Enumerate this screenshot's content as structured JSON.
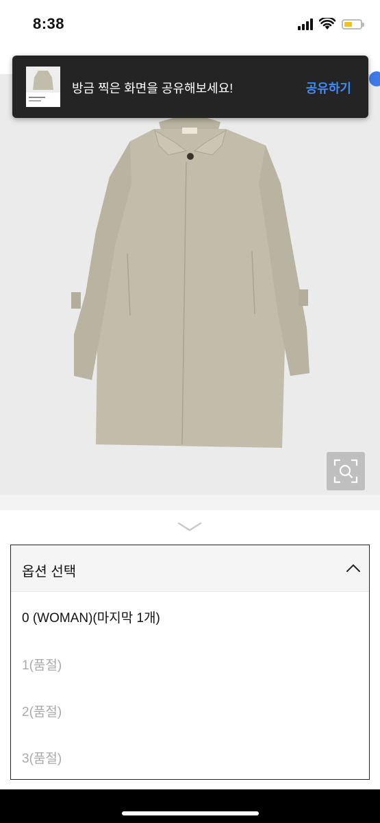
{
  "status_bar": {
    "time": "8:38",
    "battery_color": "#f4c21c"
  },
  "share_toast": {
    "message": "방금 찍은 화면을 공유해보세요!",
    "action_label": "공유하기",
    "action_color": "#3d8cff"
  },
  "product": {
    "zoom_icon": "zoom-search-icon",
    "coat_color": "#c1bba9"
  },
  "options": {
    "header_label": "옵션 선택",
    "items": [
      {
        "label": "0 (WOMAN)(마지막 1개)",
        "available": true
      },
      {
        "label": "1(품절)",
        "available": false
      },
      {
        "label": "2(품절)",
        "available": false
      },
      {
        "label": "3(품절)",
        "available": false
      }
    ]
  }
}
